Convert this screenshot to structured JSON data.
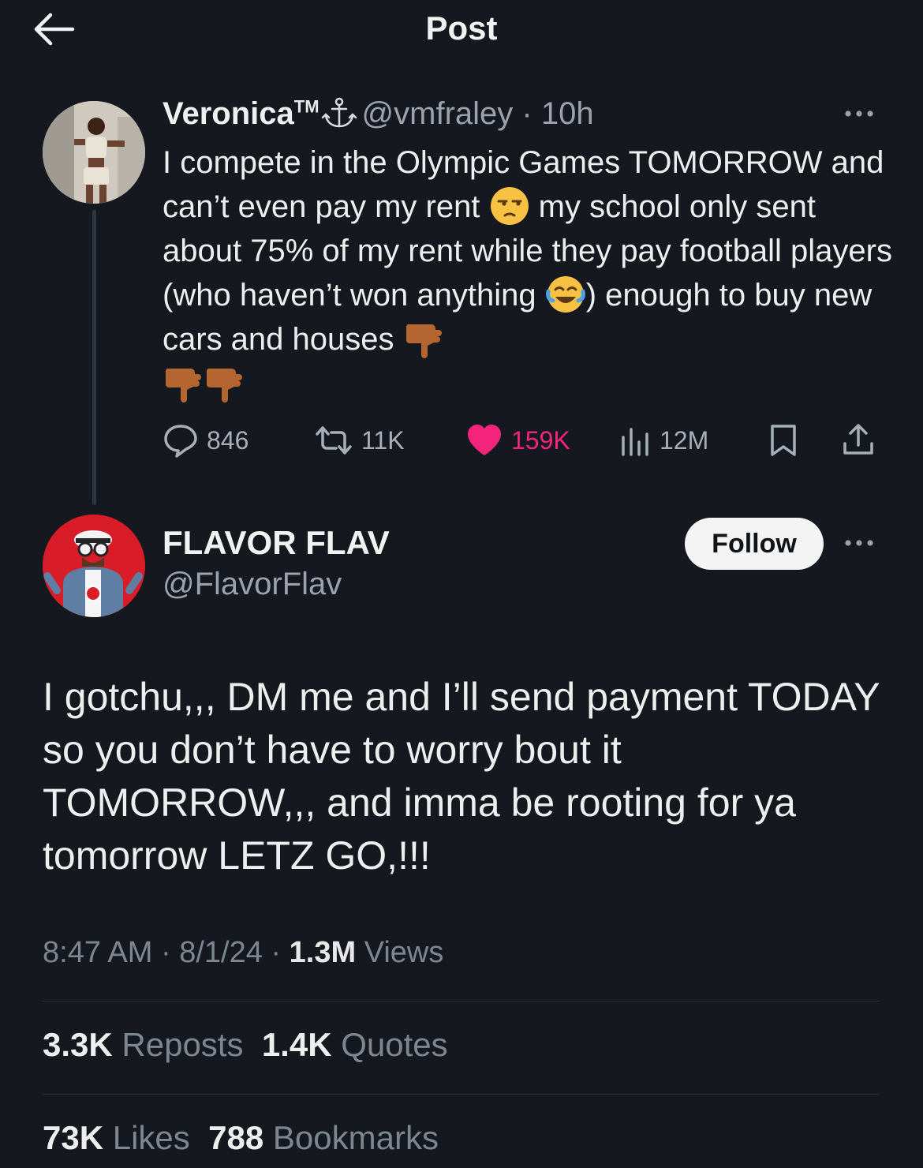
{
  "header": {
    "title": "Post"
  },
  "parent_post": {
    "name": "Veronica",
    "tm": "TM",
    "handle": "@vmfraley",
    "separator": " · ",
    "time": "10h",
    "text_1": "I compete in the Olympic Games TOMORROW and can’t even pay my rent ",
    "text_2": " my school only sent about 75% of my rent while they pay football players (who haven’t won anything ",
    "text_3": ") enough to buy new cars and houses ",
    "emojis": [
      "unamused-face",
      "face-with-tears-of-joy",
      "thumbs-down",
      "thumbs-down",
      "thumbs-down"
    ],
    "actions": {
      "replies": "846",
      "reposts": "11K",
      "likes": "159K",
      "views": "12M"
    },
    "like_color": "#f4247c"
  },
  "reply_post": {
    "name": "FLAVOR FLAV",
    "handle": "@FlavorFlav",
    "follow_label": "Follow",
    "text": "I gotchu,,, DM me and I’ll send payment TODAY so you don’t have to worry bout it TOMORROW,,, and imma be rooting for ya tomorrow LETZ GO,!!!",
    "time": "8:47 AM",
    "date": "8/1/24",
    "views_count": "1.3M",
    "views_label": "Views",
    "separator": " · ",
    "stats": {
      "reposts_count": "3.3K",
      "reposts_label": "Reposts",
      "quotes_count": "1.4K",
      "quotes_label": "Quotes",
      "likes_count": "73K",
      "likes_label": "Likes",
      "bookmarks_count": "788",
      "bookmarks_label": "Bookmarks"
    }
  },
  "colors": {
    "background": "#15191f",
    "text": "#e7e9ea",
    "secondary": "#9aa3ad",
    "follow_bg": "#f4f4f4"
  }
}
